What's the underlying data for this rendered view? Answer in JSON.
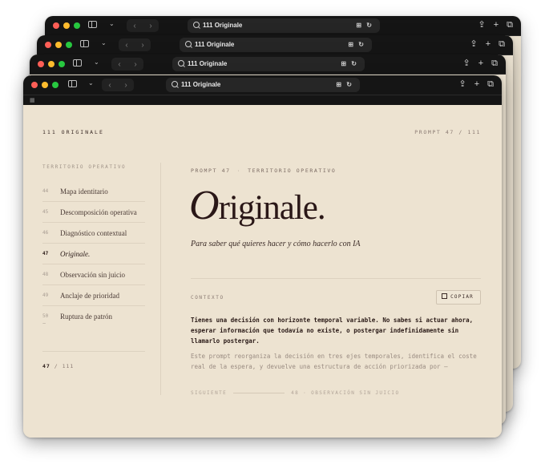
{
  "browser": {
    "address": "111 Originale"
  },
  "site": {
    "brand": "111 ORIGINALE",
    "prompt_count": "PROMPT 47 / 111"
  },
  "sidebar": {
    "heading": "TERRITORIO OPERATIVO",
    "items": [
      {
        "num": "44",
        "label": "Mapa identitario",
        "active": false
      },
      {
        "num": "45",
        "label": "Descomposición operativa",
        "active": false
      },
      {
        "num": "46",
        "label": "Diagnóstico contextual",
        "active": false
      },
      {
        "num": "47",
        "label": "Originale.",
        "active": true
      },
      {
        "num": "48",
        "label": "Observación sin juicio",
        "active": false
      },
      {
        "num": "49",
        "label": "Anclaje de prioridad",
        "active": false
      },
      {
        "num": "50",
        "label": "Ruptura de patrón",
        "active": false
      }
    ],
    "tilde": "~",
    "pager_current": "47",
    "pager_total": "/ 111"
  },
  "main": {
    "eyebrow_prompt": "PROMPT 47",
    "eyebrow_territory": "TERRITORIO OPERATIVO",
    "title_cap": "O",
    "title_rest": "riginale.",
    "subtitle": "Para saber qué quieres hacer y cómo hacerlo con IA",
    "context_label": "CONTEXTO",
    "copy_label": "COPIAR",
    "context_strong": "Tienes una decisión con horizonte temporal variable. No sabes si actuar ahora, esperar información que todavía no existe, o postergar indefinidamente sin llamarlo postergar.",
    "context_muted": "Este prompt reorganiza la decisión en tres ejes temporales, identifica el coste real de la espera, y devuelve una estructura de acción priorizada por —",
    "next_label": "SIGUIENTE",
    "next_target": "48 · OBSERVACIÓN SIN JUICIO"
  }
}
